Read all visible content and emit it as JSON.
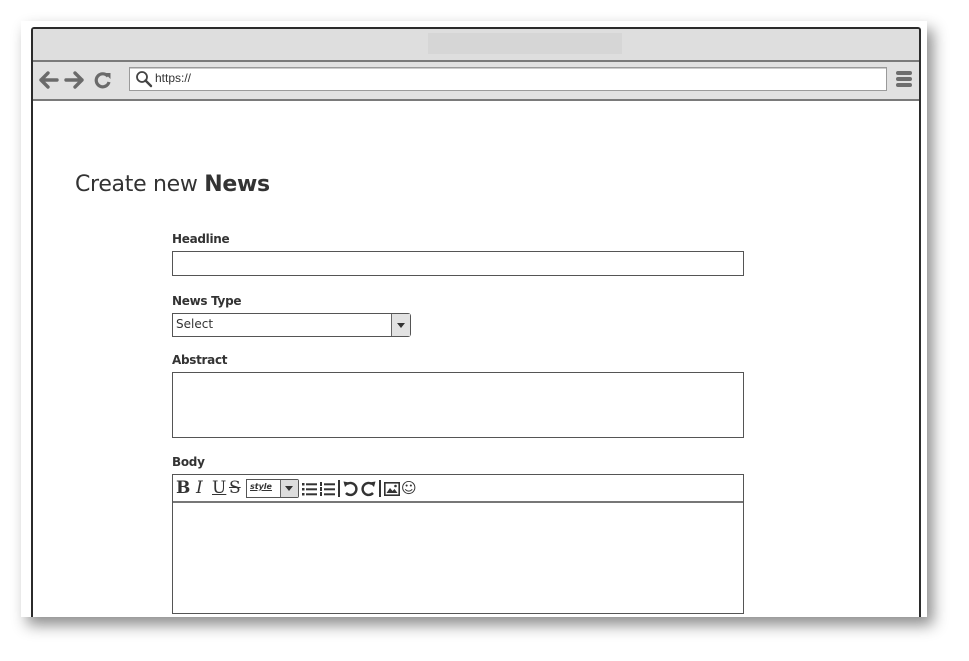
{
  "browser": {
    "url": "https://",
    "icons": {
      "back": "arrow-left-icon",
      "forward": "arrow-right-icon",
      "reload": "reload-icon",
      "search": "search-icon",
      "menu": "hamburger-menu-icon"
    },
    "glyphs": {
      "back": "🡐",
      "forward": "🡒",
      "reload": "C"
    }
  },
  "page": {
    "title_prefix": "Create new ",
    "title_bold": "News"
  },
  "form": {
    "headline": {
      "label": "Headline",
      "value": ""
    },
    "news_type": {
      "label": "News Type",
      "selected": "Select"
    },
    "abstract": {
      "label": "Abstract",
      "value": ""
    },
    "body": {
      "label": "Body",
      "value": "",
      "toolbar": {
        "bold": "B",
        "italic": "I",
        "underline": "U",
        "strike": "S",
        "style_selected": "style",
        "bullet_list": "bulleted-list-icon",
        "numbered_list": "numbered-list-icon",
        "undo": "undo-icon",
        "redo": "redo-icon",
        "image": "image-icon",
        "emoji": "☺"
      }
    }
  }
}
